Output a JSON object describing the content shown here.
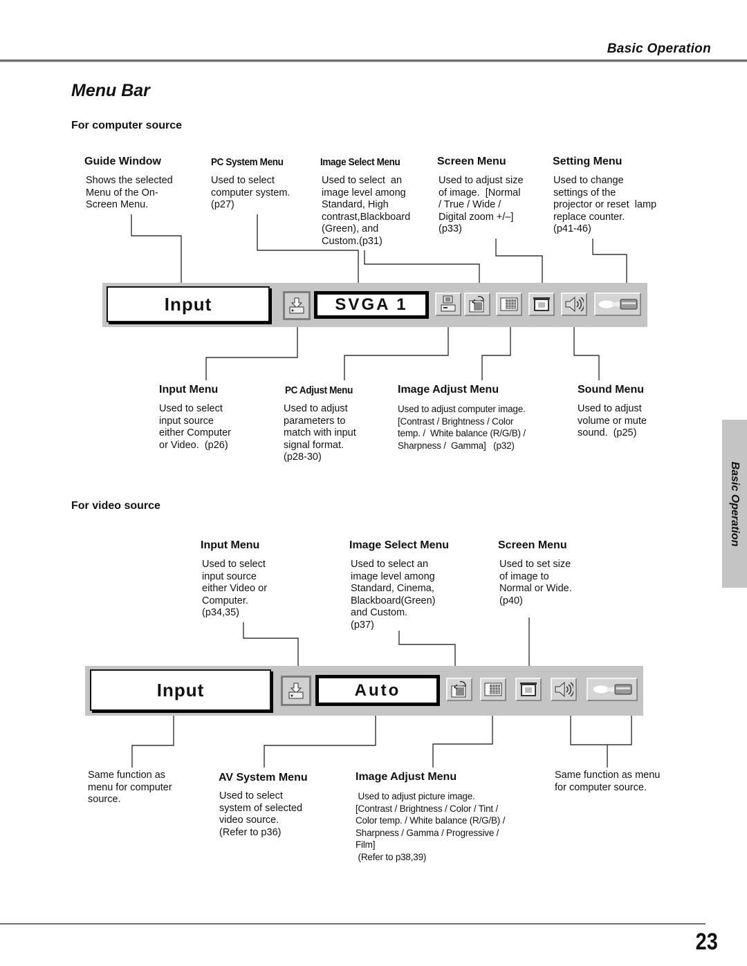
{
  "header": {
    "section_title": "Basic Operation"
  },
  "page": {
    "title": "Menu Bar",
    "number": "23"
  },
  "side_tab": {
    "label": "Basic Operation"
  },
  "computer_source": {
    "heading": "For computer source",
    "top_menus": [
      {
        "title": "Guide Window",
        "desc": "Shows the selected\nMenu of the On-\nScreen Menu."
      },
      {
        "title": "PC System Menu",
        "desc": "Used to select\ncomputer system.\n(p27)"
      },
      {
        "title": "Image Select Menu",
        "desc": "Used to select  an\nimage level among\nStandard, High\ncontrast,Blackboard\n(Green), and\nCustom.(p31)"
      },
      {
        "title": "Screen Menu",
        "desc": "Used to adjust size\nof image.  [Normal\n/ True / Wide /\nDigital zoom +/–]\n(p33)"
      },
      {
        "title": "Setting Menu",
        "desc": "Used to change\nsettings of the\nprojector or reset  lamp\nreplace counter.\n(p41-46)"
      }
    ],
    "menubar": {
      "guide_label": "Input",
      "value_label": "SVGA 1",
      "icons": [
        "input-menu-icon",
        "pc-adjust-icon",
        "image-select-icon",
        "image-adjust-icon",
        "screen-icon",
        "sound-icon",
        "setting-icon"
      ]
    },
    "bottom_menus": [
      {
        "title": "Input Menu",
        "desc": "Used to select\ninput source\neither Computer\nor Video.  (p26)"
      },
      {
        "title": "PC Adjust Menu",
        "desc": "Used to adjust\nparameters to\nmatch with input\nsignal format.\n(p28-30)"
      },
      {
        "title": "Image Adjust Menu",
        "desc": "Used to adjust computer image.\n[Contrast / Brightness / Color\ntemp. /  White balance (R/G/B) /\nSharpness /  Gamma]   (p32)"
      },
      {
        "title": "Sound Menu",
        "desc": "Used to adjust\nvolume or mute\nsound.  (p25)"
      }
    ]
  },
  "video_source": {
    "heading": "For video source",
    "top_menus": [
      {
        "title": "Input Menu",
        "desc": "Used to select\ninput source\neither Video or\nComputer.\n(p34,35)"
      },
      {
        "title": "Image Select Menu",
        "desc": "Used to select an\nimage level among\nStandard, Cinema,\nBlackboard(Green)\nand Custom.\n(p37)"
      },
      {
        "title": "Screen Menu",
        "desc": "Used to set size\nof image to\nNormal or Wide.\n(p40)"
      }
    ],
    "menubar": {
      "guide_label": "Input",
      "value_label": "Auto",
      "icons": [
        "input-menu-icon",
        "image-select-icon",
        "image-adjust-icon",
        "screen-icon",
        "sound-icon",
        "setting-icon"
      ]
    },
    "bottom_left_note": "Same function as\nmenu for computer\nsource.",
    "bottom_menus": [
      {
        "title": "AV System Menu",
        "desc": "Used to select\nsystem of selected\nvideo source.\n(Refer to p36)"
      },
      {
        "title": "Image Adjust Menu",
        "desc": " Used to adjust picture image.\n[Contrast / Brightness / Color / Tint /\nColor temp. / White balance (R/G/B) /\nSharpness / Gamma / Progressive /\nFilm]\n (Refer to p38,39)"
      }
    ],
    "bottom_right_note": "Same function as menu\nfor computer source."
  }
}
